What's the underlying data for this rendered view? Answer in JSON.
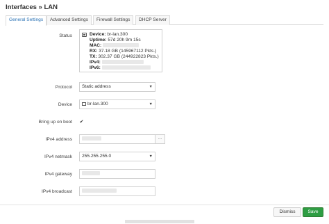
{
  "dialog": {
    "title": "Interfaces » LAN"
  },
  "tabs": [
    {
      "label": "General Settings",
      "active": true
    },
    {
      "label": "Advanced Settings",
      "active": false
    },
    {
      "label": "Firewall Settings",
      "active": false
    },
    {
      "label": "DHCP Server",
      "active": false
    }
  ],
  "status": {
    "label": "Status",
    "device_key": "Device:",
    "device_val": "br-lan.300",
    "uptime_key": "Uptime:",
    "uptime_val": "57d 20h 9m 15s",
    "mac_key": "MAC:",
    "rx_key": "RX:",
    "rx_val": "37.18 GB (145967112 Pkts.)",
    "tx_key": "TX:",
    "tx_val": "302.37 GB (244922823 Pkts.)",
    "ipv4_key": "IPv4:",
    "ipv6_key": "IPv6:"
  },
  "form": {
    "protocol_label": "Protocol",
    "protocol_value": "Static address",
    "device_label": "Device",
    "device_value": "br-lan.300",
    "bootup_label": "Bring up on boot",
    "bootup_checked": true,
    "ipv4_address_label": "IPv4 address",
    "ipv4_address_button": "...",
    "ipv4_netmask_label": "IPv4 netmask",
    "ipv4_netmask_value": "255.255.255.0",
    "ipv4_gateway_label": "IPv4 gateway",
    "ipv4_broadcast_label": "IPv4 broadcast"
  },
  "footer": {
    "dismiss_label": "Dismiss",
    "save_label": "Save"
  },
  "colors": {
    "tab_active_text": "#2a72b5",
    "save_button": "#2e9d43"
  },
  "icons": {
    "status": "network-device-icon",
    "device": "network-device-icon",
    "select_caret": "chevron-down-icon",
    "checkbox": "checkmark-icon"
  }
}
